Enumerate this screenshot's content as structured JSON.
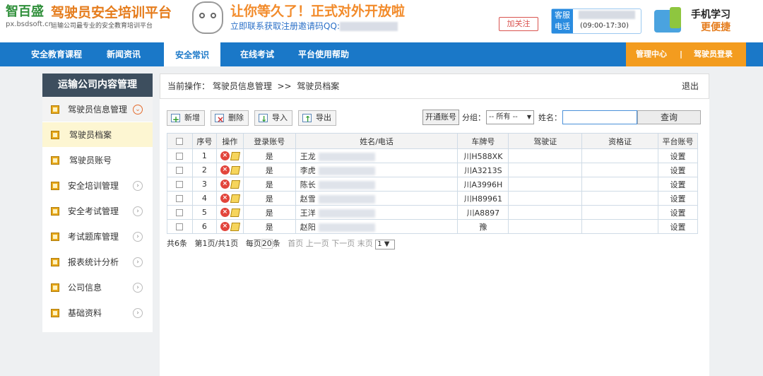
{
  "header": {
    "brand": "智百盛",
    "domain": "px.bsdsoft.cn",
    "title": "驾驶员安全培训平台",
    "tagline": "运输公司最专业的安全教育培训平台",
    "promo_line1": "让你等久了！正式对外开放啦",
    "promo_line2": "立即联系获取注册邀请码QQ:",
    "weibo": "加关注",
    "hotline_label1": "客服",
    "hotline_label2": "电话",
    "hotline_hours": "(09:00-17:30)",
    "mobile_line1": "手机学习",
    "mobile_line2": "更便捷"
  },
  "nav": {
    "items": [
      "安全教育课程",
      "新闻资讯",
      "安全常识",
      "在线考试",
      "平台使用帮助"
    ],
    "active": "安全常识",
    "admin": "管理中心",
    "separator": "|",
    "login": "驾驶员登录"
  },
  "sidebar": {
    "title": "运输公司内容管理",
    "items": [
      {
        "label": "驾驶员信息管理",
        "state": "open"
      },
      {
        "label": "驾驶员档案",
        "state": "selected"
      },
      {
        "label": "驾驶员账号",
        "state": "sub"
      },
      {
        "label": "安全培训管理"
      },
      {
        "label": "安全考试管理"
      },
      {
        "label": "考试题库管理"
      },
      {
        "label": "报表统计分析"
      },
      {
        "label": "公司信息"
      },
      {
        "label": "基础资料"
      }
    ]
  },
  "breadcrumb": {
    "prefix": "当前操作：",
    "level1": "驾驶员信息管理",
    "sep": ">>",
    "level2": "驾驶员档案",
    "logout": "退出"
  },
  "toolbar": {
    "add": "新增",
    "delete": "删除",
    "import": "导入",
    "export": "导出",
    "open_account": "开通账号",
    "group_label": "分组：",
    "group_value": "-- 所有 --",
    "name_label": "姓名：",
    "name_value": "",
    "search": "查询"
  },
  "table": {
    "headers": [
      "序号",
      "操作",
      "登录账号",
      "姓名/电话",
      "车牌号",
      "驾驶证",
      "资格证",
      "平台账号"
    ],
    "rows": [
      {
        "no": "1",
        "login": "是",
        "name": "王龙",
        "plate": "川H588XK",
        "license": "",
        "cert": "",
        "account": "设置"
      },
      {
        "no": "2",
        "login": "是",
        "name": "李虎",
        "plate": "川A3213S",
        "license": "",
        "cert": "",
        "account": "设置"
      },
      {
        "no": "3",
        "login": "是",
        "name": "陈长",
        "plate": "川A3996H",
        "license": "",
        "cert": "",
        "account": "设置"
      },
      {
        "no": "4",
        "login": "是",
        "name": "赵雪",
        "plate": "川H89961",
        "license": "",
        "cert": "",
        "account": "设置"
      },
      {
        "no": "5",
        "login": "是",
        "name": "王洋",
        "plate": "川A8897",
        "license": "",
        "cert": "",
        "account": "设置"
      },
      {
        "no": "6",
        "login": "是",
        "name": "赵阳",
        "plate": "豫",
        "license": "",
        "cert": "",
        "account": "设置"
      }
    ]
  },
  "pager": {
    "total": "共6条",
    "page_info": "第1页/共1页",
    "per_page_label": "每页",
    "per_page": "20",
    "unit": "条",
    "first": "首页",
    "prev": "上一页",
    "next": "下一页",
    "last": "末页",
    "page_select": "1"
  },
  "colors": {
    "nav_blue": "#1a78c8",
    "accent_orange": "#f39c1f",
    "sidebar_head": "#3d4e5e"
  }
}
